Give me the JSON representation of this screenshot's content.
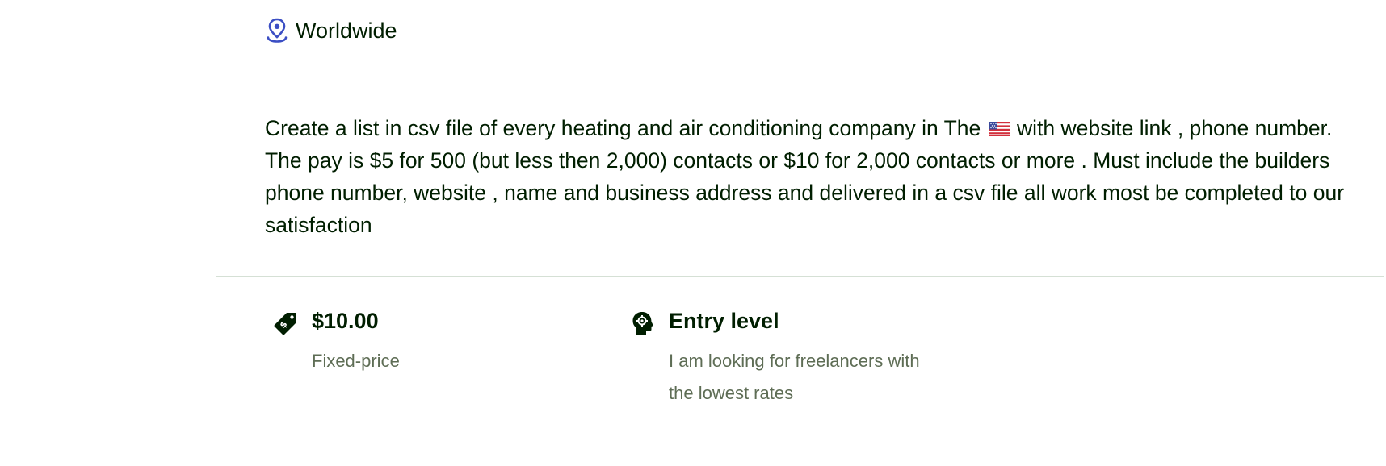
{
  "location": {
    "icon": "location-pin-icon",
    "label": "Worldwide"
  },
  "description": {
    "before_flag": "Create a list in csv file of every heating and air conditioning company in The ",
    "flag_icon": "us-flag-icon",
    "after_flag": " with website link , phone number. The pay is $5 for 500 (but less then 2,000) contacts or $10 for 2,000 contacts or more . Must include the builders phone number, website , name and business address and delivered in a csv file all work most be completed to our satisfaction"
  },
  "features": {
    "price": {
      "icon": "price-tag-icon",
      "title": "$10.00",
      "subtitle": "Fixed-price"
    },
    "level": {
      "icon": "experience-head-icon",
      "title": "Entry level",
      "subtitle_line1": "I am looking for freelancers with",
      "subtitle_line2": "the lowest rates"
    }
  },
  "colors": {
    "text": "#001e00",
    "muted": "#5e6d55",
    "divider": "#d5e0d5",
    "pin": "#3c4fc4"
  }
}
